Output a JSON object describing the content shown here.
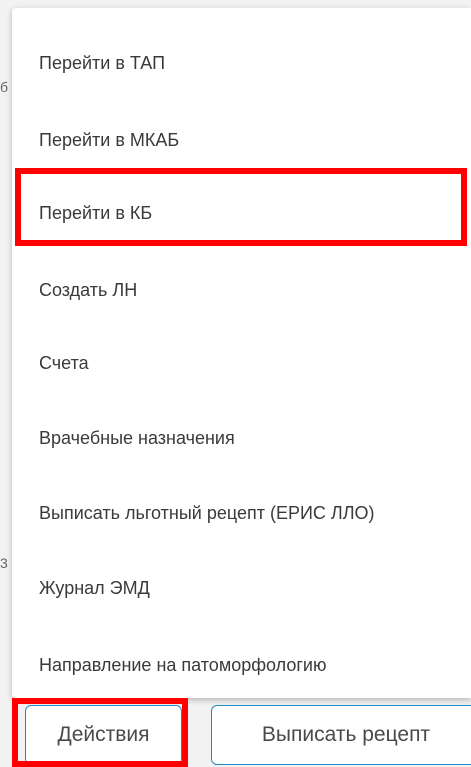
{
  "menu": {
    "items": [
      {
        "label": "Перейти в ТАП"
      },
      {
        "label": "Перейти в МКАБ"
      },
      {
        "label": "Перейти в КБ"
      },
      {
        "label": "Создать ЛН"
      },
      {
        "label": "Счета"
      },
      {
        "label": "Врачебные назначения"
      },
      {
        "label": "Выписать льготный рецепт (ЕРИС ЛЛО)"
      },
      {
        "label": "Журнал ЭМД"
      },
      {
        "label": "Направление на патоморфологию"
      }
    ]
  },
  "toolbar": {
    "actions_label": "Действия",
    "prescription_label": "Выписать рецепт"
  },
  "colors": {
    "highlight": "#ff0000",
    "button_border": "#1e88c9"
  }
}
